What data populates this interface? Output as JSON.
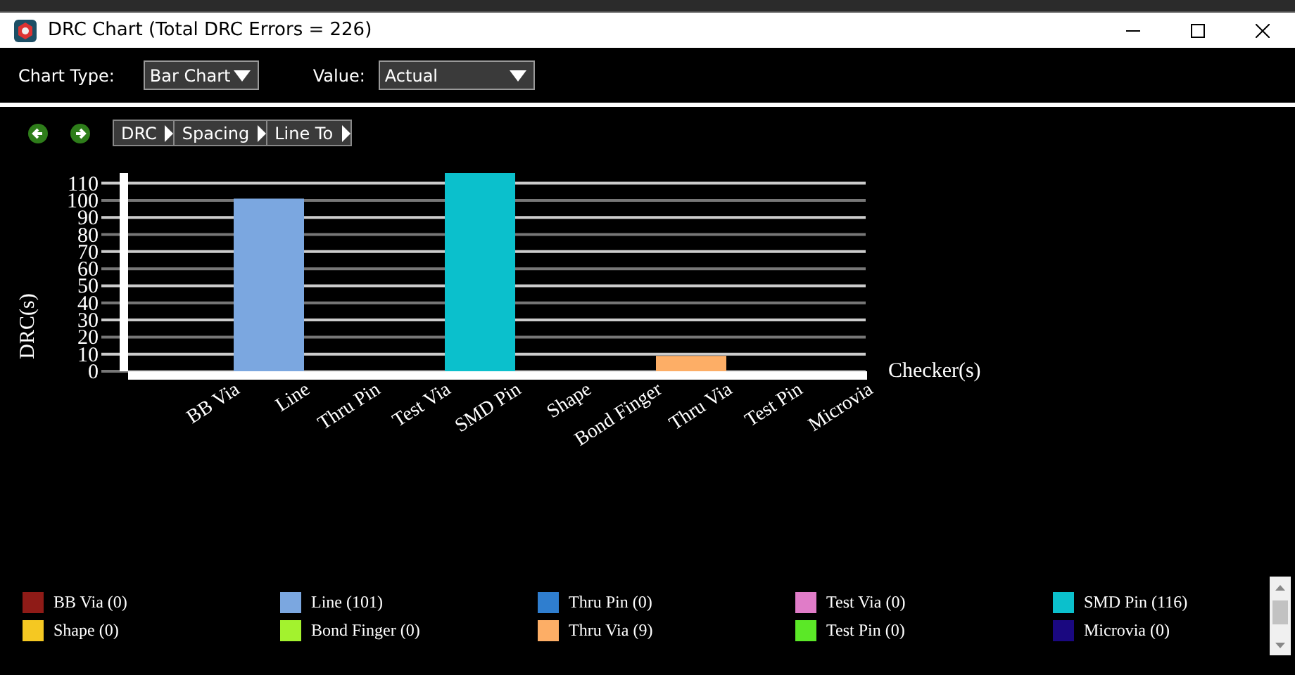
{
  "window": {
    "title": "DRC Chart (Total DRC Errors = 226)"
  },
  "toolbar": {
    "chart_type": {
      "label": "Chart Type:",
      "value": "Bar Chart"
    },
    "value": {
      "label": "Value:",
      "value": "Actual"
    }
  },
  "breadcrumb": [
    "DRC",
    "Spacing",
    "Line To"
  ],
  "chart": {
    "chart_data": {
      "type": "bar",
      "xlabel": "Checker(s)",
      "ylabel": "DRC(s)",
      "categories": [
        "BB Via",
        "Line",
        "Thru Pin",
        "Test Via",
        "SMD Pin",
        "Shape",
        "Bond Finger",
        "Thru Via",
        "Test Pin",
        "Microvia"
      ],
      "series": [
        {
          "values": [
            0,
            101,
            0,
            0,
            116,
            0,
            0,
            9,
            0,
            0
          ]
        }
      ],
      "ylim": [
        0,
        116
      ],
      "grid": true,
      "yticks": [
        0,
        10,
        20,
        30,
        40,
        50,
        60,
        70,
        80,
        90,
        100,
        110
      ]
    }
  },
  "legend": [
    {
      "label": "BB Via (0)",
      "color": "#8f1b17"
    },
    {
      "label": "Line (101)",
      "color": "#7ba7e0"
    },
    {
      "label": "Thru Pin (0)",
      "color": "#2f7ecf"
    },
    {
      "label": "Test Via (0)",
      "color": "#e07cc8"
    },
    {
      "label": "SMD Pin (116)",
      "color": "#0bc0cc"
    },
    {
      "label": "Shape (0)",
      "color": "#f5c822"
    },
    {
      "label": "Bond Finger (0)",
      "color": "#a3f22e"
    },
    {
      "label": "Thru Via (9)",
      "color": "#fdae66"
    },
    {
      "label": "Test Pin (0)",
      "color": "#5be827"
    },
    {
      "label": "Microvia (0)",
      "color": "#1a0880"
    }
  ]
}
